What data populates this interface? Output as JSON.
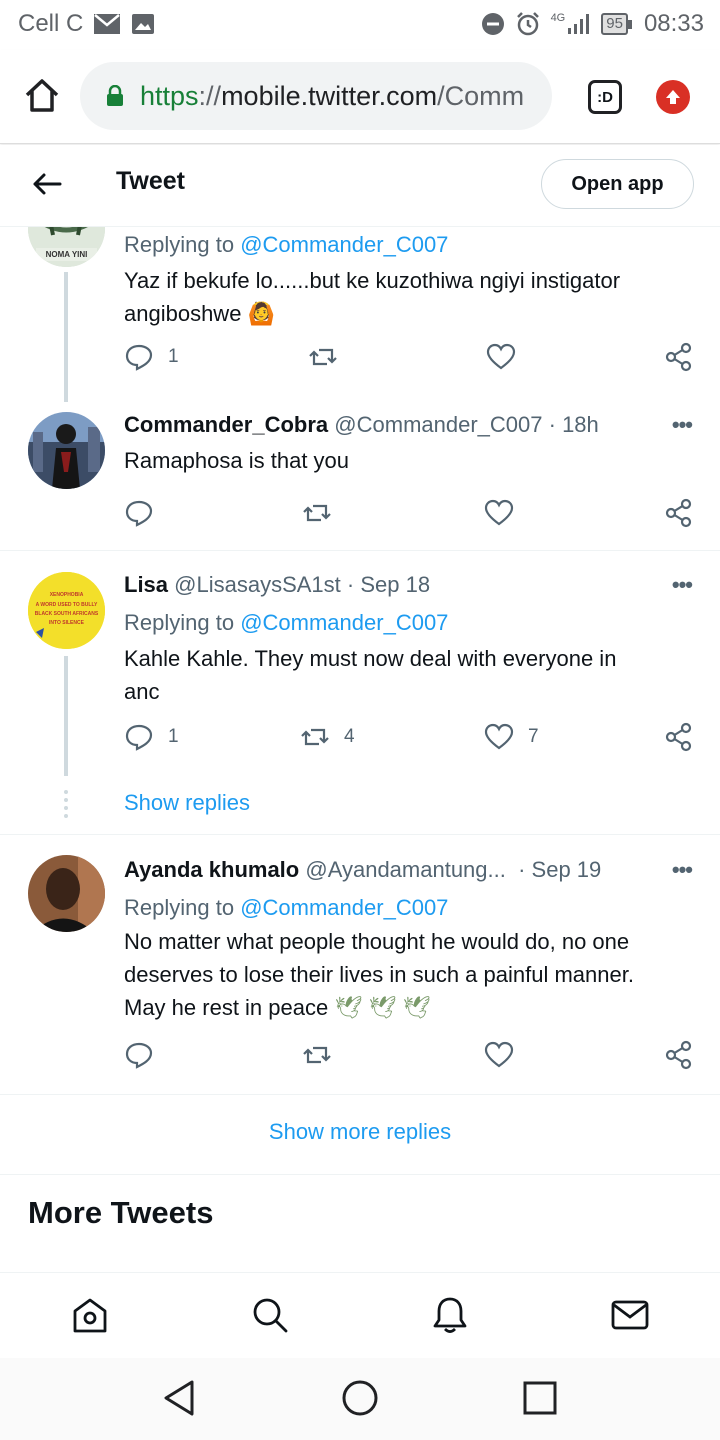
{
  "status_bar": {
    "carrier": "Cell C",
    "network": "4G",
    "battery": "95",
    "time": "08:33"
  },
  "browser": {
    "url_scheme": "https",
    "url_sep": "://",
    "url_host": "mobile.twitter.com",
    "url_path": "/Comm",
    "tabs_label": ":D"
  },
  "header": {
    "title": "Tweet",
    "open_app": "Open app"
  },
  "tweets": [
    {
      "reply_prefix": "Replying to",
      "reply_to": "@Commander_C007",
      "text_line1": "Yaz if bekufe lo......but ke kuzothiwa ngiyi instigator",
      "text_line2": "angiboshwe",
      "emoji": "🙆",
      "reply_count": "1",
      "retweet_count": "",
      "like_count": ""
    },
    {
      "name": "Commander_Cobra",
      "handle": "@Commander_C007",
      "time": "· 18h",
      "text": "Ramaphosa is that you",
      "reply_count": "",
      "retweet_count": "",
      "like_count": ""
    },
    {
      "name": "Lisa",
      "handle": "@LisasaysSA1st",
      "time": "· Sep 18",
      "reply_prefix": "Replying to",
      "reply_to": "@Commander_C007",
      "text_line1": "Kahle Kahle. They must now deal with everyone in",
      "text_line2": "anc",
      "reply_count": "1",
      "retweet_count": "4",
      "like_count": "7",
      "show_replies": "Show replies"
    },
    {
      "name": "Ayanda khumalo",
      "handle": "@Ayandamantung...",
      "time": "· Sep 19",
      "reply_prefix": "Replying to",
      "reply_to": "@Commander_C007",
      "text_line1": "No matter what people thought he would do, no one",
      "text_line2": "deserves to lose their lives in such a painful manner.",
      "text_line3": "May he rest in peace",
      "emoji": "🕊 🕊 🕊",
      "reply_count": "",
      "retweet_count": "",
      "like_count": ""
    }
  ],
  "show_more_replies": "Show more replies",
  "more_tweets": "More Tweets",
  "avatar_texts": {
    "first": "NOMA YINI",
    "lisa_line1": "XENOPHOBIA",
    "lisa_line2": "A WORD USED TO BULLY",
    "lisa_line3": "BLACK SOUTH AFRICANS",
    "lisa_line4": "INTO SILENCE"
  },
  "colors": {
    "accent": "#1d9bf0",
    "muted": "#536471",
    "text": "#0f1419"
  }
}
